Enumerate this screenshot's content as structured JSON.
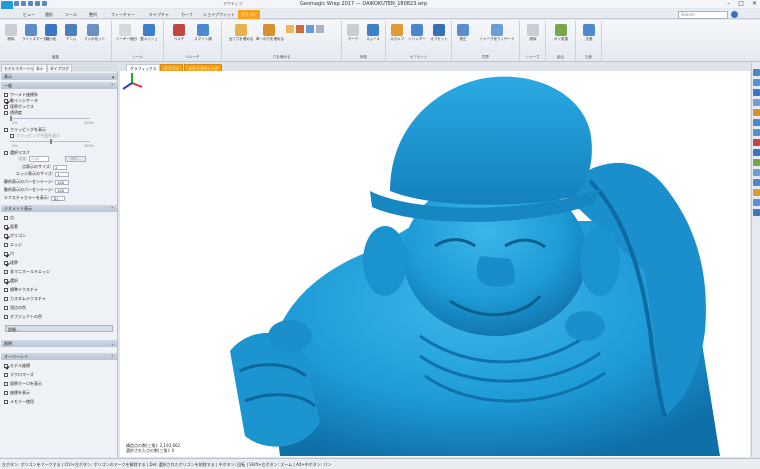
{
  "window": {
    "title": "Geomagic Wrap 2017 — DAIKOKUTEN_180823.wrp",
    "context_label": "アクティブ",
    "search_placeholder": "Search"
  },
  "ribbon_tabs": [
    "ビュー",
    "選択",
    "ツール",
    "整列",
    "フィーチャー",
    "キャプチャ",
    "カーブ",
    "ショイプフィット",
    "ポリゴン"
  ],
  "ribbon": {
    "groups": [
      {
        "name": "編集",
        "buttons": [
          "削除",
          "ライトスマーダー",
          "縮小化",
          "アニム",
          "マンボ化ッド"
        ]
      },
      {
        "name": "ツール",
        "buttons": [
          "ツーギー細分",
          "整メッシュ"
        ]
      },
      {
        "name": "ベルーチ",
        "buttons": [
          "ベルチ",
          "スマイト補"
        ]
      },
      {
        "name": "穴を埋める",
        "buttons": [
          "全て穴を埋める",
          "単一の穴を埋める"
        ]
      },
      {
        "name": "修復",
        "buttons": [
          "マーク",
          "スムース"
        ]
      },
      {
        "name": "オフセット",
        "buttons": [
          "スカルプ",
          "シリンダー",
          "オフセット"
        ]
      },
      {
        "name": "境界",
        "buttons": [
          "修正",
          "シャープ化ウィザード"
        ]
      },
      {
        "name": "シャープ",
        "buttons": [
          "削除"
        ]
      },
      {
        "name": "組合",
        "buttons": [
          "ポリ変換"
        ]
      },
      {
        "name": "交差",
        "buttons": [
          "交差"
        ]
      }
    ]
  },
  "left_panel": {
    "tabs": [
      "モデルマネージャ",
      "表示",
      "ダイアログ"
    ],
    "display_header": "表示",
    "general": {
      "header": "一般",
      "world_axes": "ワールド座標系",
      "dynamic_display": "動インジケータ",
      "bounding_box": "境界ボックス",
      "transparency": "透明度",
      "pct_min": "0%",
      "pct_max": "100%",
      "show_clipping": "クリッピングを表示",
      "clipping_plane": "クリッピング平面を表示",
      "selection_mask": "選択マスク",
      "depth_label": "深度:",
      "depth_value": "0.00",
      "apply_button": "操作...",
      "point_size_label": "点表示のサイズ:",
      "point_size_value": "2",
      "edge_size_label": "エッジ表示のサイズ:",
      "edge_size_value": "1",
      "static_label": "静的表示のパーセンテージ:",
      "static_value": "100",
      "dynamic_label": "動的表示のパーセンテージ:",
      "dynamic_value": "100",
      "texture_label": "テクスチャカラーを表示:",
      "texture_value": "なし"
    },
    "object_display": {
      "header": "ジオメトリ表示",
      "items": [
        {
          "label": "点",
          "checked": false
        },
        {
          "label": "面素",
          "checked": true
        },
        {
          "label": "ポリゴン",
          "checked": true
        },
        {
          "label": "エッジ",
          "checked": false
        },
        {
          "label": "穴",
          "checked": true
        },
        {
          "label": "境界",
          "checked": true
        },
        {
          "label": "非マニホールドエッジ",
          "checked": false
        },
        {
          "label": "選択",
          "checked": true
        },
        {
          "label": "標準テクスチャ",
          "checked": false
        },
        {
          "label": "カスタムテクスチャ",
          "checked": false
        },
        {
          "label": "頂点の色",
          "checked": false
        },
        {
          "label": "オブジェクトの色",
          "checked": false
        }
      ],
      "details_button": "詳細..."
    },
    "lighting_header": "照明",
    "overlay": {
      "header": "オーバーレイ",
      "items": [
        {
          "label": "モデル座標",
          "checked": true
        },
        {
          "label": "マクロマーズ",
          "checked": false
        },
        {
          "label": "境界ボーロを表示",
          "checked": false
        },
        {
          "label": "座標を表示",
          "checked": false
        },
        {
          "label": "メモリー使用",
          "checked": false
        }
      ]
    }
  },
  "viewport": {
    "tabs": [
      "グラフィックス",
      "ポリゴン",
      "スクリプティング"
    ],
    "selection_info_line1": "構造点の数(三角): 2,193,662",
    "selection_info_line2": "選択された点の数(三角): 0",
    "model_color": "#1e9bd6"
  },
  "status_bar": {
    "text": "左ボタン: ポリゴンをマークする | Ctrl+左ボタン: ポリゴンのマークを解除する | Del: 選択されたポリゴンを削除する | 中ボタン: 回転 | Shift+左ボタン: ズーム | Alt+中ボタン: パン"
  }
}
